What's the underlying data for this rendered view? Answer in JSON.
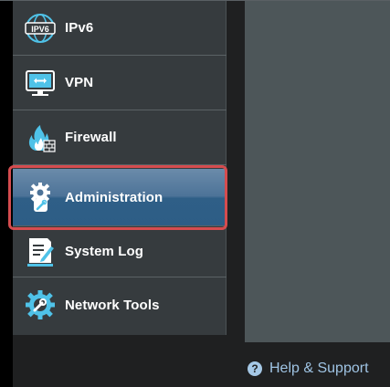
{
  "sidebar": {
    "items": [
      {
        "label": "IPv6",
        "icon": "ipv6-globe-icon"
      },
      {
        "label": "VPN",
        "icon": "vpn-monitor-icon"
      },
      {
        "label": "Firewall",
        "icon": "firewall-icon"
      },
      {
        "label": "Administration",
        "icon": "gear-wrench-icon",
        "active": true
      },
      {
        "label": "System Log",
        "icon": "system-log-icon"
      },
      {
        "label": "Network Tools",
        "icon": "network-tools-icon"
      }
    ],
    "ipv6_icon_text": "IPV6"
  },
  "footer": {
    "help_label": "Help & Support",
    "help_icon_glyph": "?"
  },
  "colors": {
    "sidebar_bg": "#363b3e",
    "active_bg": "#2f5f87",
    "highlight_outline": "#d54c4f",
    "panel_bg": "#4d5659",
    "help_link": "#9fc4e4",
    "icon_blue": "#4fc2e8"
  }
}
